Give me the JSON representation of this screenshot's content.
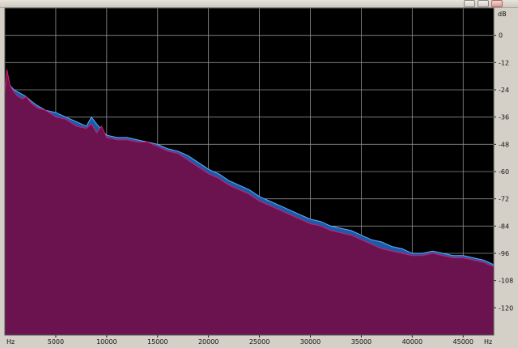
{
  "window": {
    "title_buttons": [
      "minimize-icon",
      "maximize-icon",
      "close-icon"
    ]
  },
  "chart_data": {
    "type": "area",
    "xlabel": "Hz",
    "ylabel": "dB",
    "x_unit_left": "Hz",
    "x_unit_right": "Hz",
    "xlim": [
      0,
      48000
    ],
    "ylim": [
      -132,
      12
    ],
    "x_ticks": [
      "5000",
      "10000",
      "15000",
      "20000",
      "25000",
      "30000",
      "35000",
      "40000",
      "45000"
    ],
    "y_ticks": [
      "0",
      "-12",
      "-24",
      "-36",
      "-48",
      "-60",
      "-72",
      "-84",
      "-96",
      "-108",
      "-120"
    ],
    "grid": true,
    "background": "#000000",
    "series": [
      {
        "color": "#1e5aa8",
        "points": [
          [
            0,
            -26
          ],
          [
            200,
            -18
          ],
          [
            500,
            -22
          ],
          [
            900,
            -24
          ],
          [
            1300,
            -25
          ],
          [
            1700,
            -26
          ],
          [
            2100,
            -27
          ],
          [
            2600,
            -29
          ],
          [
            3200,
            -31
          ],
          [
            4000,
            -33
          ],
          [
            5000,
            -34
          ],
          [
            6000,
            -36
          ],
          [
            7000,
            -38
          ],
          [
            8000,
            -40
          ],
          [
            8500,
            -36
          ],
          [
            9000,
            -39
          ],
          [
            10000,
            -44
          ],
          [
            11000,
            -45
          ],
          [
            12000,
            -45
          ],
          [
            13000,
            -46
          ],
          [
            14000,
            -47
          ],
          [
            15000,
            -48
          ],
          [
            16000,
            -50
          ],
          [
            17000,
            -51
          ],
          [
            18000,
            -53
          ],
          [
            19000,
            -56
          ],
          [
            20000,
            -59
          ],
          [
            21000,
            -61
          ],
          [
            22000,
            -64
          ],
          [
            23000,
            -66
          ],
          [
            24000,
            -68
          ],
          [
            25000,
            -71
          ],
          [
            26000,
            -73
          ],
          [
            27000,
            -75
          ],
          [
            28000,
            -77
          ],
          [
            29000,
            -79
          ],
          [
            30000,
            -81
          ],
          [
            31000,
            -82
          ],
          [
            32000,
            -84
          ],
          [
            33000,
            -85
          ],
          [
            34000,
            -86
          ],
          [
            35000,
            -88
          ],
          [
            36000,
            -90
          ],
          [
            37000,
            -91
          ],
          [
            38000,
            -93
          ],
          [
            39000,
            -94
          ],
          [
            40000,
            -96
          ],
          [
            41000,
            -96
          ],
          [
            42000,
            -95
          ],
          [
            43000,
            -96
          ],
          [
            44000,
            -97
          ],
          [
            45000,
            -97
          ],
          [
            46000,
            -98
          ],
          [
            47000,
            -99
          ],
          [
            48000,
            -101
          ]
        ]
      },
      {
        "color": "#d11c6d",
        "points": [
          [
            0,
            -26
          ],
          [
            200,
            -15
          ],
          [
            500,
            -22
          ],
          [
            900,
            -25
          ],
          [
            1300,
            -27
          ],
          [
            1700,
            -28
          ],
          [
            2100,
            -27
          ],
          [
            2600,
            -30
          ],
          [
            3200,
            -32
          ],
          [
            4000,
            -33
          ],
          [
            5000,
            -36
          ],
          [
            6000,
            -37
          ],
          [
            7000,
            -40
          ],
          [
            8000,
            -41
          ],
          [
            8500,
            -39
          ],
          [
            9000,
            -43
          ],
          [
            9500,
            -40
          ],
          [
            10000,
            -45
          ],
          [
            11000,
            -46
          ],
          [
            12000,
            -46
          ],
          [
            13000,
            -47
          ],
          [
            14000,
            -47
          ],
          [
            15000,
            -49
          ],
          [
            16000,
            -51
          ],
          [
            17000,
            -52
          ],
          [
            18000,
            -55
          ],
          [
            19000,
            -58
          ],
          [
            20000,
            -61
          ],
          [
            21000,
            -63
          ],
          [
            22000,
            -66
          ],
          [
            23000,
            -68
          ],
          [
            24000,
            -70
          ],
          [
            25000,
            -73
          ],
          [
            26000,
            -75
          ],
          [
            27000,
            -77
          ],
          [
            28000,
            -79
          ],
          [
            29000,
            -81
          ],
          [
            30000,
            -83
          ],
          [
            31000,
            -84
          ],
          [
            32000,
            -86
          ],
          [
            33000,
            -87
          ],
          [
            34000,
            -88
          ],
          [
            35000,
            -90
          ],
          [
            36000,
            -92
          ],
          [
            37000,
            -94
          ],
          [
            38000,
            -95
          ],
          [
            39000,
            -96
          ],
          [
            40000,
            -97
          ],
          [
            41000,
            -97
          ],
          [
            42000,
            -96
          ],
          [
            43000,
            -97
          ],
          [
            44000,
            -98
          ],
          [
            45000,
            -98
          ],
          [
            46000,
            -99
          ],
          [
            47000,
            -100
          ],
          [
            48000,
            -102
          ]
        ]
      }
    ],
    "fill_color": "#6a134f"
  }
}
